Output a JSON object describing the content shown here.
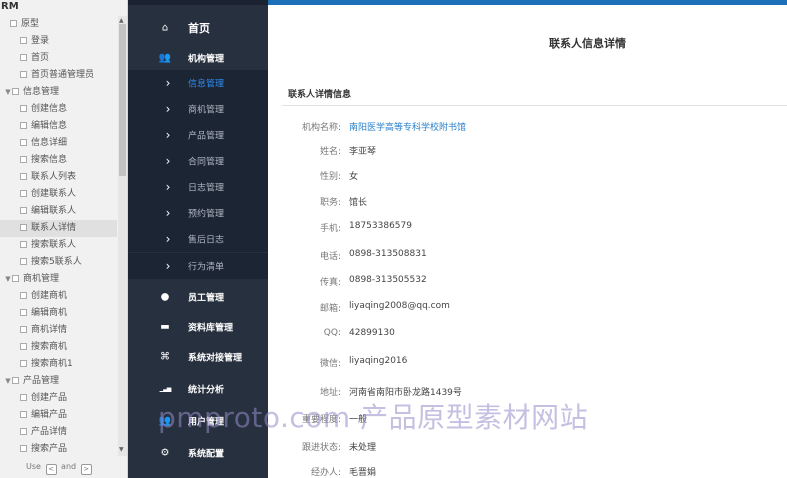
{
  "tree": {
    "title": "RM",
    "items": [
      {
        "label": "原型",
        "toggle": "",
        "sel": false
      },
      {
        "label": "登录",
        "toggle": "",
        "sel": false
      },
      {
        "label": "首页",
        "toggle": "",
        "sel": false
      },
      {
        "label": "首页普通管理员",
        "toggle": "",
        "sel": false
      },
      {
        "label": "信息管理",
        "toggle": "▼",
        "sel": false
      },
      {
        "label": "创建信息",
        "toggle": "",
        "sel": false
      },
      {
        "label": "编辑信息",
        "toggle": "",
        "sel": false
      },
      {
        "label": "信息详细",
        "toggle": "",
        "sel": false
      },
      {
        "label": "搜索信息",
        "toggle": "",
        "sel": false
      },
      {
        "label": "联系人列表",
        "toggle": "",
        "sel": false
      },
      {
        "label": "创建联系人",
        "toggle": "",
        "sel": false
      },
      {
        "label": "编辑联系人",
        "toggle": "",
        "sel": false
      },
      {
        "label": "联系人详情",
        "toggle": "",
        "sel": true
      },
      {
        "label": "搜索联系人",
        "toggle": "",
        "sel": false
      },
      {
        "label": "搜索5联系人",
        "toggle": "",
        "sel": false
      },
      {
        "label": "商机管理",
        "toggle": "▼",
        "sel": false
      },
      {
        "label": "创建商机",
        "toggle": "",
        "sel": false
      },
      {
        "label": "编辑商机",
        "toggle": "",
        "sel": false
      },
      {
        "label": "商机详情",
        "toggle": "",
        "sel": false
      },
      {
        "label": "搜索商机",
        "toggle": "",
        "sel": false
      },
      {
        "label": "搜索商机1",
        "toggle": "",
        "sel": false
      },
      {
        "label": "产品管理",
        "toggle": "▼",
        "sel": false
      },
      {
        "label": "创建产品",
        "toggle": "",
        "sel": false
      },
      {
        "label": "编辑产品",
        "toggle": "",
        "sel": false
      },
      {
        "label": "产品详情",
        "toggle": "",
        "sel": false
      },
      {
        "label": "搜索产品",
        "toggle": "",
        "sel": false
      }
    ],
    "footer_use": "Use",
    "footer_and": "and",
    "footer_key_left": "<",
    "footer_key_right": ">"
  },
  "sidebar": {
    "home": "首页",
    "items": [
      {
        "label": "机构管理",
        "icon": "users-icon",
        "glyph": "👥",
        "kind": "section"
      },
      {
        "label": "信息管理",
        "icon": "chevron-right-icon",
        "glyph": "›",
        "kind": "sub-active"
      },
      {
        "label": "商机管理",
        "icon": "chevron-right-icon",
        "glyph": "›",
        "kind": "sub"
      },
      {
        "label": "产品管理",
        "icon": "chevron-right-icon",
        "glyph": "›",
        "kind": "sub"
      },
      {
        "label": "合同管理",
        "icon": "chevron-right-icon",
        "glyph": "›",
        "kind": "sub"
      },
      {
        "label": "日志管理",
        "icon": "chevron-right-icon",
        "glyph": "›",
        "kind": "sub"
      },
      {
        "label": "预约管理",
        "icon": "chevron-right-icon",
        "glyph": "›",
        "kind": "sub"
      },
      {
        "label": "售后日志",
        "icon": "chevron-right-icon",
        "glyph": "›",
        "kind": "sub"
      },
      {
        "label": "行为清单",
        "icon": "chevron-right-icon",
        "glyph": "›",
        "kind": "sub"
      },
      {
        "label": "员工管理",
        "icon": "user-icon",
        "glyph": "●",
        "kind": "section"
      },
      {
        "label": "资料库管理",
        "icon": "folder-icon",
        "glyph": "▬",
        "kind": "section"
      },
      {
        "label": "系统对接管理",
        "icon": "connect-icon",
        "glyph": "⌘",
        "kind": "section"
      },
      {
        "label": "统计分析",
        "icon": "bar-chart-icon",
        "glyph": "▁▃▅",
        "kind": "section"
      },
      {
        "label": "用户管理",
        "icon": "users-icon",
        "glyph": "👥",
        "kind": "section"
      },
      {
        "label": "系统配置",
        "icon": "gears-icon",
        "glyph": "⚙",
        "kind": "section"
      }
    ]
  },
  "content": {
    "page_title": "联系人信息详情",
    "section_title": "联系人详情信息",
    "fields": [
      {
        "key": "机构名称:",
        "value": "南阳医学高等专科学校附书馆",
        "link": true
      },
      {
        "key": "姓名:",
        "value": "李亚琴",
        "link": false
      },
      {
        "key": "性别:",
        "value": "女",
        "link": false
      },
      {
        "key": "职务:",
        "value": "馆长",
        "link": false
      },
      {
        "key": "手机:",
        "value": "18753386579",
        "link": false
      },
      {
        "key": "电话:",
        "value": "0898-313508831",
        "link": false
      },
      {
        "key": "传真:",
        "value": "0898-313505532",
        "link": false
      },
      {
        "key": "邮箱:",
        "value": "liyaqing2008@qq.com",
        "link": false
      },
      {
        "key": "QQ:",
        "value": "42899130",
        "link": false
      },
      {
        "key": "微信:",
        "value": "liyaqing2016",
        "link": false
      },
      {
        "key": "地址:",
        "value": "河南省南阳市卧龙路1439号",
        "link": false
      },
      {
        "key": "重要程度:",
        "value": "一般",
        "link": false
      },
      {
        "key": "跟进状态:",
        "value": "未处理",
        "link": false
      },
      {
        "key": "经办人:",
        "value": "毛晋娟",
        "link": false
      }
    ]
  },
  "watermark": "pmproto.com 产品原型素材网站",
  "colors": {
    "sidebar_bg": "#27303e",
    "active_link": "#2d8cf0",
    "topbar": "#1d6fb8"
  }
}
